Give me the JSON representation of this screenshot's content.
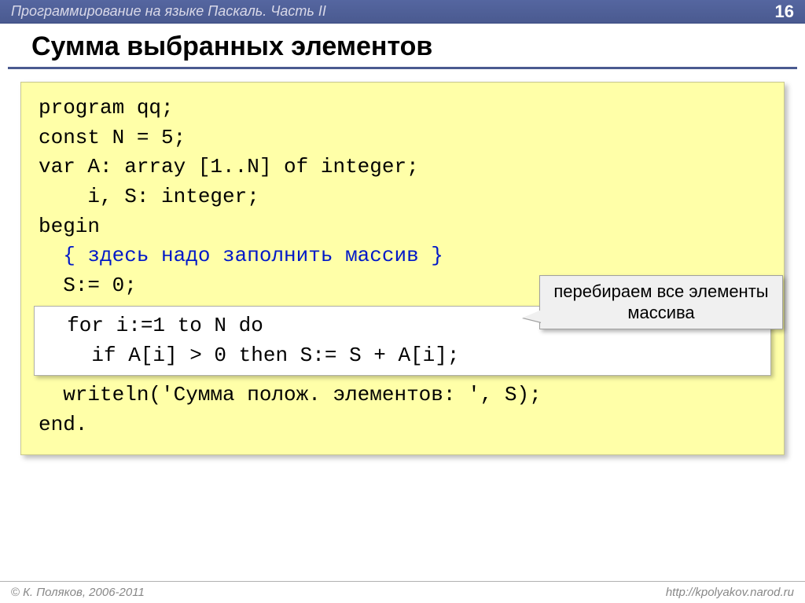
{
  "header": {
    "title": "Программирование на языке Паскаль. Часть II",
    "page": "16"
  },
  "title": "Сумма выбранных элементов",
  "code": {
    "l1": "program qq;",
    "l2": "const N = 5;",
    "l3": "var A: array [1..N] of integer;",
    "l4": "    i, S: integer;",
    "l5": "begin",
    "l6": "  { здесь надо заполнить массив }",
    "l7": "  S:= 0;",
    "l8a": "  for i:=1 to N do",
    "l8b": "    if A[i] > 0 then S:= S + A[i];",
    "l9": "  writeln('Сумма полож. элементов: ', S);",
    "l10": "end."
  },
  "callout": "перебираем все элементы массива",
  "footer": {
    "left": "К. Поляков, 2006-2011",
    "right": "http://kpolyakov.narod.ru"
  }
}
